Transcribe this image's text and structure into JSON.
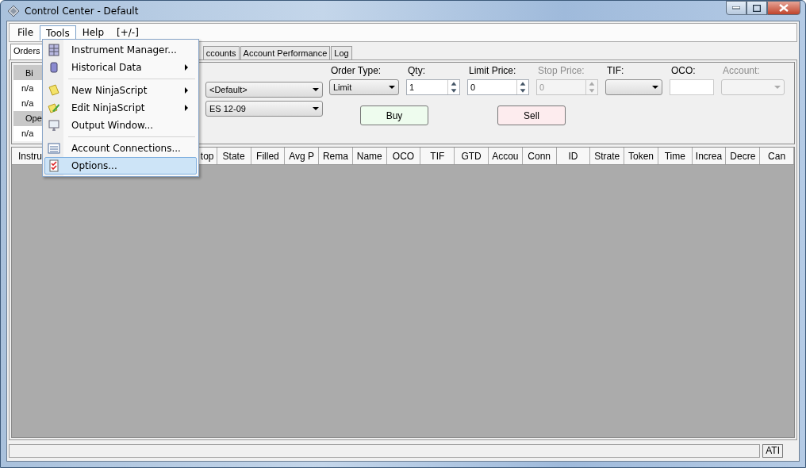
{
  "window": {
    "title": "Control Center - Default"
  },
  "menu_bar": [
    {
      "label": "File",
      "selected": false
    },
    {
      "label": "Tools",
      "selected": true
    },
    {
      "label": "Help",
      "selected": false
    },
    {
      "label": "[+/-]",
      "selected": false
    }
  ],
  "tools_menu": [
    {
      "kind": "item",
      "label": "Instrument Manager...",
      "submenu": false,
      "selected": false
    },
    {
      "kind": "item",
      "label": "Historical Data",
      "submenu": true,
      "selected": false
    },
    {
      "kind": "separator"
    },
    {
      "kind": "item",
      "label": "New NinjaScript",
      "submenu": true,
      "selected": false
    },
    {
      "kind": "item",
      "label": "Edit NinjaScript",
      "submenu": true,
      "selected": false
    },
    {
      "kind": "item",
      "label": "Output Window...",
      "submenu": false,
      "selected": false
    },
    {
      "kind": "separator"
    },
    {
      "kind": "item",
      "label": "Account Connections...",
      "submenu": false,
      "selected": false
    },
    {
      "kind": "item",
      "label": "Options...",
      "submenu": false,
      "selected": true
    }
  ],
  "tabs": [
    {
      "label": "Orders",
      "selected": true
    },
    {
      "label": "ccounts",
      "selected": false
    },
    {
      "label": "Account Performance",
      "selected": false
    },
    {
      "label": "Log",
      "selected": false
    }
  ],
  "quote_panel": [
    {
      "kind": "header",
      "text": "Bi"
    },
    {
      "kind": "value",
      "text": "n/a"
    },
    {
      "kind": "value",
      "text": "n/a"
    },
    {
      "kind": "header",
      "text": "Ope"
    },
    {
      "kind": "value",
      "text": "n/a"
    }
  ],
  "instrument_combos": [
    "<Default>",
    "ES 12-09"
  ],
  "order_fields": [
    {
      "label": "Order Type:",
      "kind": "combo",
      "value": "Limit",
      "disabled": false
    },
    {
      "label": "Qty:",
      "kind": "spinner",
      "value": "1",
      "disabled": false
    },
    {
      "label": "Limit Price:",
      "kind": "spinner",
      "value": "0",
      "disabled": false
    },
    {
      "label": "Stop Price:",
      "kind": "spinner",
      "value": "0",
      "disabled": true
    },
    {
      "label": "TIF:",
      "kind": "combo",
      "disabled": false
    },
    {
      "label": "OCO:",
      "kind": "text",
      "disabled": false
    },
    {
      "label": "Account:",
      "kind": "combo",
      "disabled": true
    }
  ],
  "action_buttons": [
    {
      "label": "Buy",
      "kind": "buy"
    },
    {
      "label": "Sell",
      "kind": "sell"
    }
  ],
  "order_columns": [
    "Instru",
    "top",
    "State",
    "Filled",
    "Avg P",
    "Rema",
    "Name",
    "OCO",
    "TIF",
    "GTD",
    "Accou",
    "Conn",
    "ID",
    "Strate",
    "Token",
    "Time",
    "Increa",
    "Decre",
    "Can"
  ],
  "status_bar": {
    "panel": "ATI"
  }
}
